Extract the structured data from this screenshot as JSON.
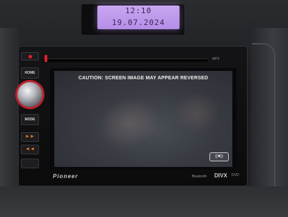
{
  "clock": {
    "time": "12:10",
    "date": "19.07.2024"
  },
  "head_unit": {
    "brand": "Pioneer",
    "slot_label": "MP3",
    "buttons": {
      "home": "HOME",
      "mode": "MODE",
      "next": "►►",
      "prev": "◄◄"
    },
    "logos": {
      "bluetooth": "Bluetooth",
      "divx": "DIVX",
      "dvd": "DVD"
    }
  },
  "screen": {
    "caution_text": "CAUTION: SCREEN IMAGE MAY APPEAR REVERSED",
    "button_icon": "camera-toggle-icon",
    "button_label": "((■))"
  },
  "colors": {
    "clock_lcd": "#c9a6f0",
    "accent_red": "#e0202a",
    "skip_orange": "#e47b2a"
  }
}
